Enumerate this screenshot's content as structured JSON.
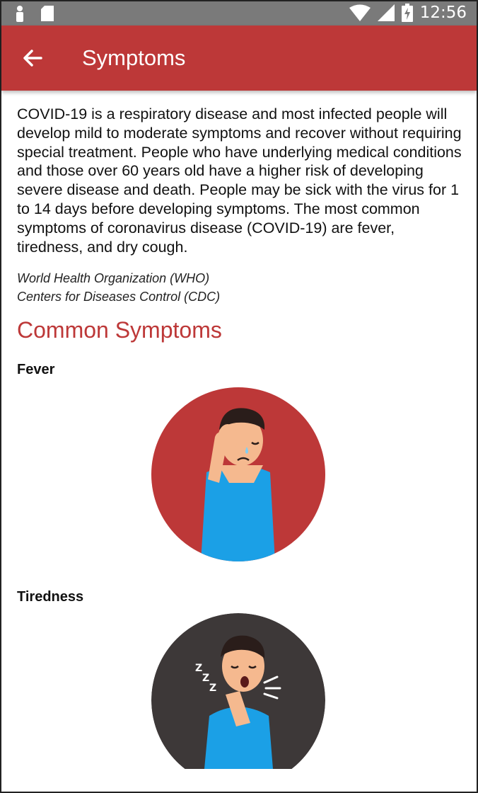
{
  "status_bar": {
    "time": "12:56"
  },
  "app_bar": {
    "title": "Symptoms"
  },
  "intro": "COVID-19 is a respiratory disease and most infected people will develop mild to moderate symptoms and recover without requiring special treatment.  People who have underlying medical conditions and those over 60 years old have a higher risk of developing severe disease and death. People may be sick with the virus for 1 to 14 days before developing symptoms. The most common symptoms of coronavirus disease (COVID-19) are fever, tiredness, and dry cough.",
  "sources": [
    "World Health Organization (WHO)",
    "Centers for Diseases Control (CDC)"
  ],
  "section_title": "Common Symptoms",
  "symptoms": [
    {
      "label": "Fever",
      "icon": "fever-illustration",
      "circle_color": "#bd3838"
    },
    {
      "label": "Tiredness",
      "icon": "tiredness-illustration",
      "circle_color": "#3d3838"
    }
  ],
  "colors": {
    "accent": "#bd3838",
    "status_bar": "#7a7a7a",
    "shirt": "#1ba0e6"
  }
}
